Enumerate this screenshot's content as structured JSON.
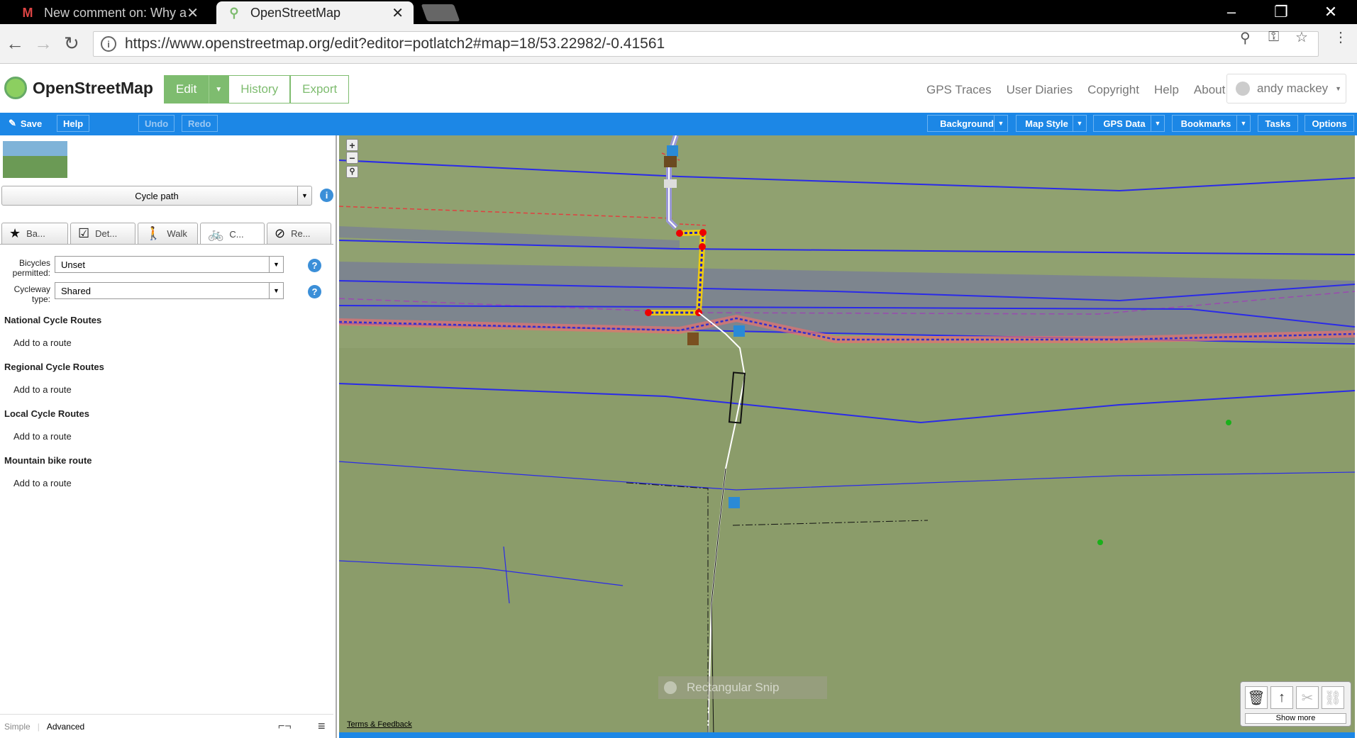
{
  "browser": {
    "tabs": [
      {
        "title": "New comment on: Why a",
        "icon": "gmail-icon"
      },
      {
        "title": "OpenStreetMap",
        "icon": "osm-icon"
      }
    ],
    "url": "https://www.openstreetmap.org/edit?editor=potlatch2#map=18/53.22982/-0.41561"
  },
  "header": {
    "brand": "OpenStreetMap",
    "edit": "Edit",
    "history": "History",
    "export": "Export",
    "nav": [
      "GPS Traces",
      "User Diaries",
      "Copyright",
      "Help",
      "About"
    ],
    "user": "andy mackey"
  },
  "toolbar": {
    "save": "Save",
    "help": "Help",
    "undo": "Undo",
    "redo": "Redo",
    "background": "Background",
    "map_style": "Map Style",
    "gps_data": "GPS Data",
    "bookmarks": "Bookmarks",
    "tasks": "Tasks",
    "options": "Options"
  },
  "panel": {
    "feature_type": "Cycle path",
    "tabs": [
      {
        "label": "Ba...",
        "icon": "star-icon"
      },
      {
        "label": "Det...",
        "icon": "checkbox-icon"
      },
      {
        "label": "Walk",
        "icon": "walker-icon"
      },
      {
        "label": "C...",
        "icon": "bicycle-icon"
      },
      {
        "label": "Re...",
        "icon": "prohibited-icon"
      }
    ],
    "bicycles_label": "Bicycles permitted:",
    "bicycles_value": "Unset",
    "cycleway_label": "Cycleway type:",
    "cycleway_value": "Shared",
    "sections": [
      {
        "title": "National Cycle Routes",
        "action": "Add to a route"
      },
      {
        "title": "Regional Cycle Routes",
        "action": "Add to a route"
      },
      {
        "title": "Local Cycle Routes",
        "action": "Add to a route"
      },
      {
        "title": "Mountain bike route",
        "action": "Add to a route"
      }
    ],
    "mode_simple": "Simple",
    "mode_advanced": "Advanced"
  },
  "map": {
    "terms": "Terms & Feedback",
    "snip": "Rectangular Snip",
    "show_more": "Show more"
  }
}
